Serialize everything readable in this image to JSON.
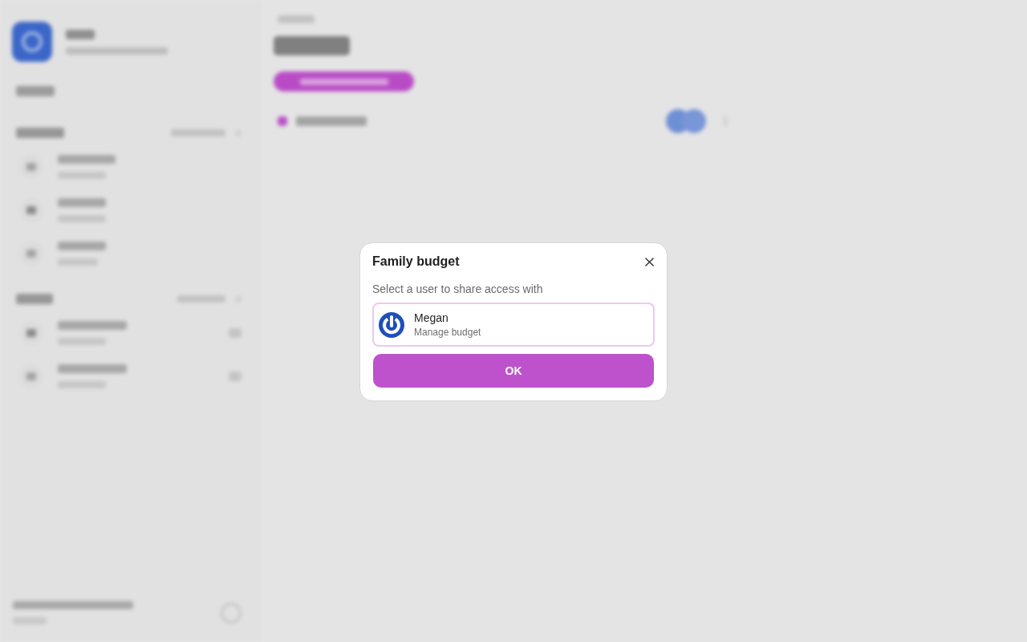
{
  "dialog": {
    "title": "Family budget",
    "prompt": "Select a user to share access with",
    "users": [
      {
        "name": "Megan",
        "role": "Manage budget",
        "selected": true
      }
    ],
    "confirm_button": "OK"
  }
}
